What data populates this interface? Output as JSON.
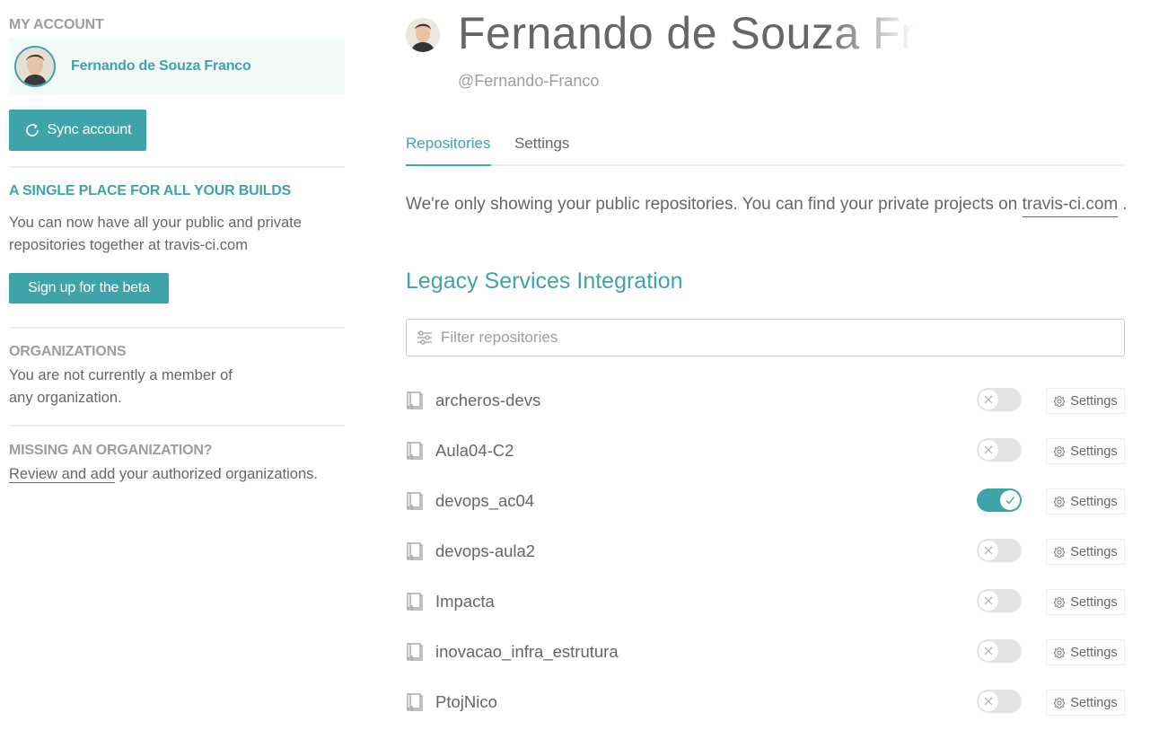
{
  "sidebar": {
    "account_heading": "MY ACCOUNT",
    "account_name": "Fernando de Souza Franco",
    "sync_label": "Sync account",
    "beta": {
      "heading": "A SINGLE PLACE FOR ALL YOUR BUILDS",
      "text": "You can now have all your public and private repositories together at travis-ci.com",
      "button_label": "Sign up for the beta"
    },
    "organizations": {
      "heading": "ORGANIZATIONS",
      "text": "You are not currently a member of any organization."
    },
    "missing": {
      "heading": "MISSING AN ORGANIZATION?",
      "link_text": "Review and add",
      "text_after": " your authorized organizations."
    }
  },
  "profile": {
    "name": "Fernando de Souza Franco",
    "login": "@Fernando-Franco"
  },
  "tabs": [
    {
      "label": "Repositories",
      "active": true
    },
    {
      "label": "Settings",
      "active": false
    }
  ],
  "notice": {
    "text": "We're only showing your public repositories. You can find your private projects on ",
    "link": "travis-ci.com",
    "after": " ."
  },
  "section_title": "Legacy Services Integration",
  "filter": {
    "placeholder": "Filter repositories"
  },
  "repo_settings_label": "Settings",
  "repos": [
    {
      "name": "archeros-devs",
      "enabled": false
    },
    {
      "name": "Aula04-C2",
      "enabled": false
    },
    {
      "name": "devops_ac04",
      "enabled": true
    },
    {
      "name": "devops-aula2",
      "enabled": false
    },
    {
      "name": "Impacta",
      "enabled": false
    },
    {
      "name": "inovacao_infra_estrutura",
      "enabled": false
    },
    {
      "name": "PtojNico",
      "enabled": false
    }
  ],
  "colors": {
    "accent": "#3fa4a9",
    "text": "#666666",
    "muted": "#9d9d9d",
    "toggle_off": "#e4e4e4"
  }
}
